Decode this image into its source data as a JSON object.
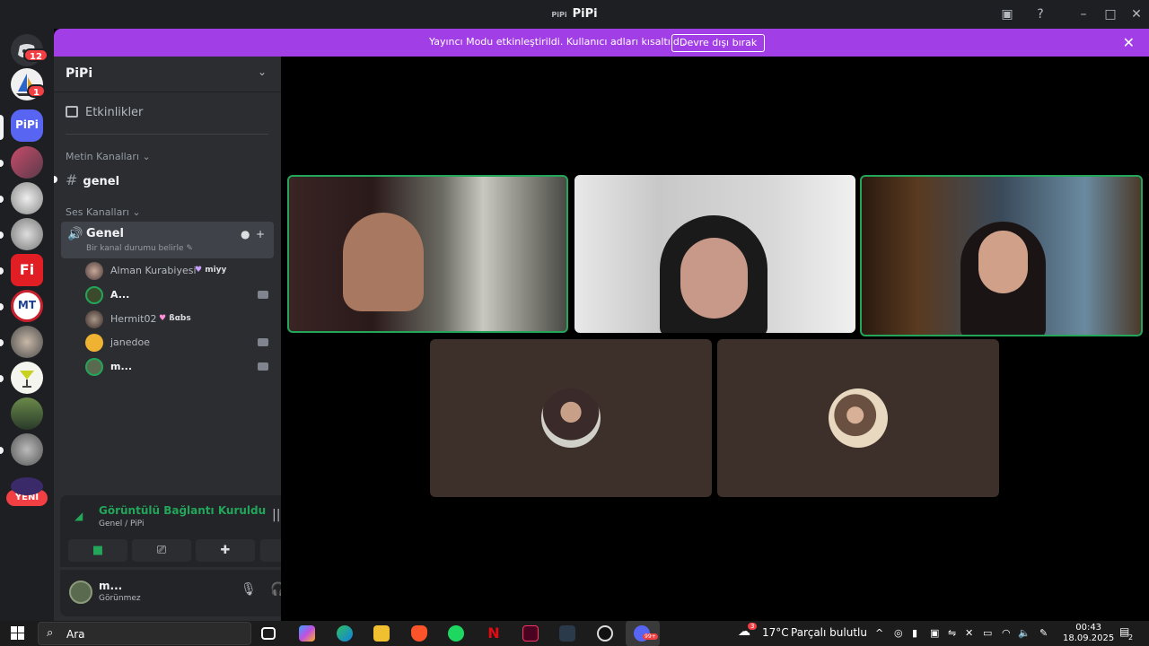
{
  "window": {
    "title_prefix": "PiPi",
    "title": "PiPi"
  },
  "guilds": {
    "dm_badge": "12",
    "second_badge": "1",
    "current_server_abbrev": "PiPi",
    "fi_abbrev": "Fi",
    "mt_abbrev": "MT",
    "new_label": "YENİ"
  },
  "banner": {
    "message": "Yayıncı Modu etkinleştirildi. Kullanıcı adları kısaltıldı.",
    "disable_button": "Devre dışı bırak"
  },
  "server": {
    "name": "PiPi",
    "events_label": "Etkinlikler",
    "text_category": "Metin Kanalları",
    "text_channel": "genel",
    "voice_category": "Ses Kanalları",
    "voice_channel": {
      "name": "Genel",
      "status_placeholder": "Bir kanal durumu belirle"
    },
    "members": [
      {
        "name": "Alman Kurabiyesi",
        "tag": "miyy",
        "tag_color": "#c9a0ff"
      },
      {
        "name": "A...",
        "tag": ""
      },
      {
        "name": "Hermit02",
        "tag": "ßαbs",
        "tag_color": "#ff8fd8"
      },
      {
        "name": "janedoe",
        "tag": ""
      },
      {
        "name": "m...",
        "tag": ""
      }
    ]
  },
  "voice_panel": {
    "status": "Görüntülü Bağlantı Kuruldu",
    "location": "Genel / PiPi"
  },
  "user_panel": {
    "name": "m...",
    "status": "Görünmez"
  },
  "taskbar": {
    "search_placeholder": "Ara",
    "weather_temp": "17°C",
    "weather_desc": "Parçalı bulutlu",
    "weather_badge": "3",
    "time": "00:43",
    "date": "18.09.2025",
    "notification_count": "2",
    "discord_badge": "99+"
  },
  "colors": {
    "banner": "#a23ee6",
    "speaking": "#23a55a",
    "danger": "#f23f43",
    "sidebar": "#2b2d31",
    "guild_bar": "#1e1f22"
  }
}
